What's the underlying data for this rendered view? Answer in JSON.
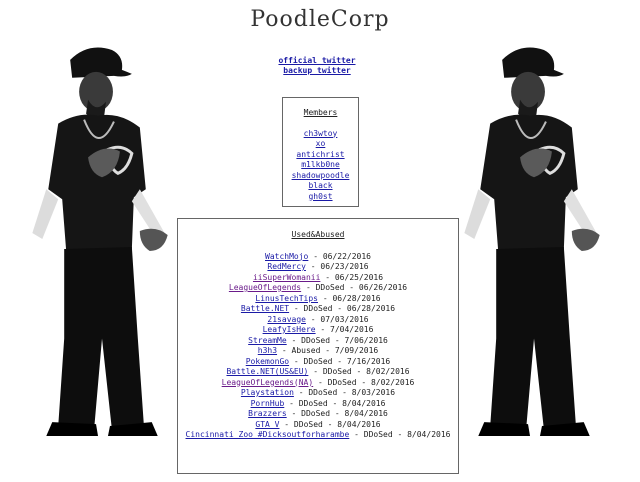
{
  "site_title": "PoodleCorp",
  "links": {
    "official_twitter": "official twitter",
    "backup_twitter": "backup twitter"
  },
  "members": {
    "heading": "Members",
    "items": [
      "ch3wtoy",
      "xo",
      "antichrist",
      "m1lkb0ne",
      "shadowpoodle",
      "black",
      "gh0st"
    ]
  },
  "used_abused": {
    "heading": "Used&Abused",
    "rows": [
      {
        "name": "WatchMojo",
        "status": "- 06/22/2016",
        "visited": false
      },
      {
        "name": "RedMercy",
        "status": "- 06/23/2016",
        "visited": false
      },
      {
        "name": "iiSuperWomanii",
        "status": "- 06/25/2016",
        "visited": true
      },
      {
        "name": "LeagueOfLegends",
        "status": "- DDoSed - 06/26/2016",
        "visited": true
      },
      {
        "name": "LinusTechTips",
        "status": "- 06/28/2016",
        "visited": false
      },
      {
        "name": "Battle.NET",
        "status": "- DDoSed - 06/28/2016",
        "visited": false
      },
      {
        "name": "21savage",
        "status": "- 07/03/2016",
        "visited": false
      },
      {
        "name": "LeafyIsHere",
        "status": "- 7/04/2016",
        "visited": false
      },
      {
        "name": "StreamMe",
        "status": "- DDoSed - 7/06/2016",
        "visited": false
      },
      {
        "name": "h3h3",
        "status": "- Abused - 7/09/2016",
        "visited": false
      },
      {
        "name": "PokemonGo",
        "status": "- DDoSed - 7/16/2016",
        "visited": false
      },
      {
        "name": "Battle.NET(US&EU)",
        "status": "- DDoSed - 8/02/2016",
        "visited": false
      },
      {
        "name": "LeagueOfLegends(NA)",
        "status": "- DDoSed - 8/02/2016",
        "visited": true
      },
      {
        "name": "Playstation",
        "status": "- DDoSed - 8/03/2016",
        "visited": false
      },
      {
        "name": "PornHub",
        "status": "- DDoSed - 8/04/2016",
        "visited": false
      },
      {
        "name": "Brazzers",
        "status": "- DDoSed - 8/04/2016",
        "visited": false
      },
      {
        "name": "GTA V",
        "status": "- DDoSed - 8/04/2016",
        "visited": false
      },
      {
        "name": "Cincinnati Zoo #Dicksoutforharambe",
        "status": "- DDoSed - 8/04/2016",
        "visited": false
      }
    ]
  },
  "colors": {
    "link": "#1a1aa6",
    "visited_link": "#6a1b8a",
    "background": "#ffffff"
  },
  "icons": {
    "left_figure": "dancing-man-image",
    "right_figure": "dancing-man-image"
  }
}
